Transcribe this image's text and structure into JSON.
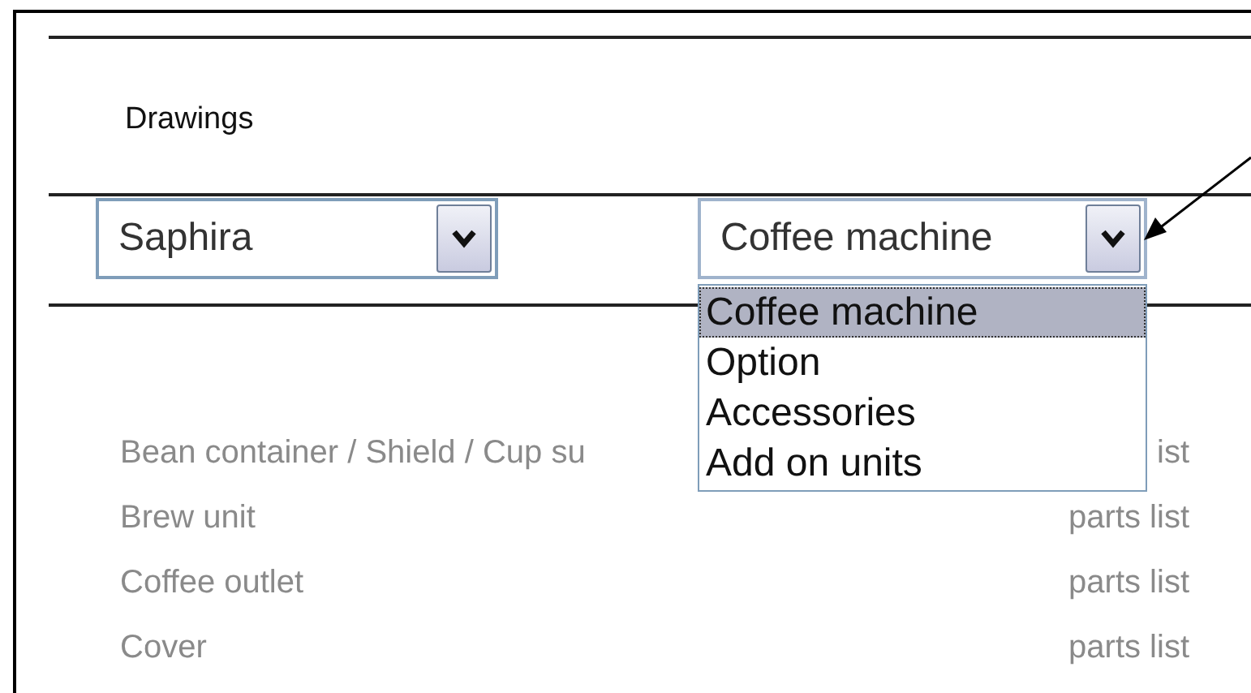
{
  "section_title": "Drawings",
  "selects": [
    {
      "value": "Saphira",
      "expanded": false
    },
    {
      "value": "Coffee machine",
      "expanded": true,
      "options": [
        {
          "label": "Coffee machine",
          "selected": true
        },
        {
          "label": "Option",
          "selected": false
        },
        {
          "label": "Accessories",
          "selected": false
        },
        {
          "label": "Add on units",
          "selected": false
        }
      ]
    }
  ],
  "rows": [
    {
      "name": "Bean container / Shield / Cup su",
      "link": "ist"
    },
    {
      "name": "Brew unit",
      "link": "parts list"
    },
    {
      "name": "Coffee outlet",
      "link": "parts list"
    },
    {
      "name": "Cover",
      "link": "parts list"
    }
  ]
}
